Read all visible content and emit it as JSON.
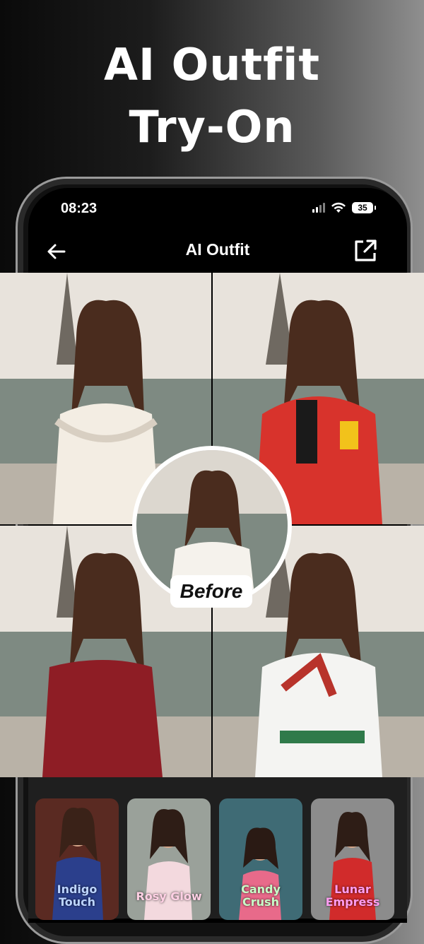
{
  "headline": {
    "line1": "AI Outfit",
    "line2": "Try-On"
  },
  "status_bar": {
    "time": "08:23",
    "battery": "35"
  },
  "nav": {
    "title": "AI Outfit",
    "back_icon": "arrow-left-icon",
    "share_icon": "share-external-icon"
  },
  "results": [
    {
      "outfit": "white pearl gown"
    },
    {
      "outfit": "red racing jacket"
    },
    {
      "outfit": "red off-shoulder dress"
    },
    {
      "outfit": "white shirt with scarf"
    }
  ],
  "before": {
    "label": "Before"
  },
  "styles": [
    {
      "label_line1": "Indigo",
      "label_line2": "Touch",
      "label_color": "#bcd4ff"
    },
    {
      "label_line1": "Rosy Glow",
      "label_line2": "",
      "label_color": "#ffd0e4"
    },
    {
      "label_line1": "Candy",
      "label_line2": "Crush",
      "label_color": "#c8ffc8"
    },
    {
      "label_line1": "Lunar",
      "label_line2": "Empress",
      "label_color": "#ff9cf0"
    }
  ]
}
